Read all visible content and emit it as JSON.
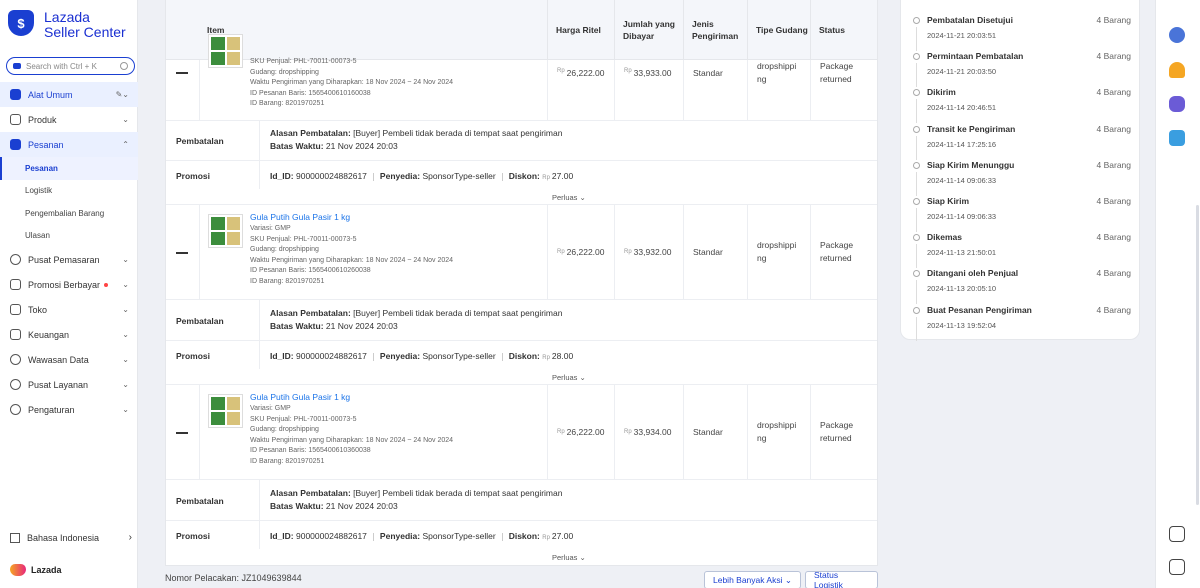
{
  "brand": {
    "line1": "Lazada",
    "line2": "Seller Center",
    "footer": "Lazada"
  },
  "search": {
    "placeholder": "Search with Ctrl + K"
  },
  "nav": {
    "alat_umum": "Alat Umum",
    "produk": "Produk",
    "pesanan": "Pesanan",
    "sub": [
      "Pesanan",
      "Logistik",
      "Pengembalian Barang",
      "Ulasan"
    ],
    "rest": [
      "Pusat Pemasaran",
      "Promosi Berbayar",
      "Toko",
      "Keuangan",
      "Wawasan Data",
      "Pusat Layanan",
      "Pengaturan"
    ],
    "language": "Bahasa Indonesia"
  },
  "table": {
    "headers": {
      "item": "Item",
      "harga": "Harga Ritel",
      "jumlah": "Jumlah yang Dibayar",
      "jenis": "Jenis Pengiriman",
      "tipe": "Tipe Gudang",
      "status": "Status"
    },
    "currency": "Rp",
    "rows": [
      {
        "name": "",
        "variasi": "",
        "sku": "SKU Penjual: PHL-70011-00073-5",
        "gudang": "Gudang: dropshipping",
        "waktu": "Waktu Pengiriman yang Diharapkan: 18 Nov 2024 ~ 24 Nov 2024",
        "id_pesanan": "ID Pesanan Baris: 1565400610160038",
        "id_barang": "ID Barang: 8201970251",
        "harga": "26,222.00",
        "jumlah": "33,933.00",
        "jenis": "Standar",
        "tipe": "dropshippi ng",
        "status": "Package returned",
        "diskon": "27.00"
      },
      {
        "name": "Gula Putih Gula Pasir 1 kg",
        "variasi": "Variasi: GMP",
        "sku": "SKU Penjual: PHL-70011-00073-5",
        "gudang": "Gudang: dropshipping",
        "waktu": "Waktu Pengiriman yang Diharapkan: 18 Nov 2024 ~ 24 Nov 2024",
        "id_pesanan": "ID Pesanan Baris: 1565400610260038",
        "id_barang": "ID Barang: 8201970251",
        "harga": "26,222.00",
        "jumlah": "33,932.00",
        "jenis": "Standar",
        "tipe": "dropshippi ng",
        "status": "Package returned",
        "diskon": "28.00"
      },
      {
        "name": "Gula Putih Gula Pasir 1 kg",
        "variasi": "Variasi: GMP",
        "sku": "SKU Penjual: PHL-70011-00073-5",
        "gudang": "Gudang: dropshipping",
        "waktu": "Waktu Pengiriman yang Diharapkan: 18 Nov 2024 ~ 24 Nov 2024",
        "id_pesanan": "ID Pesanan Baris: 1565400610360038",
        "id_barang": "ID Barang: 8201970251",
        "harga": "26,222.00",
        "jumlah": "33,934.00",
        "jenis": "Standar",
        "tipe": "dropshippi ng",
        "status": "Package returned",
        "diskon": "27.00"
      }
    ],
    "pembatalan_label": "Pembatalan",
    "alasan_label": "Alasan Pembatalan:",
    "alasan_text": "[Buyer] Pembeli tidak berada di tempat saat pengiriman",
    "batas_label": "Batas Waktu:",
    "batas_text": "21 Nov 2024 20:03",
    "promosi_label": "Promosi",
    "id_label": "Id_ID:",
    "id_value": "900000024882617",
    "penyedia_label": "Penyedia:",
    "penyedia_value": "SponsorType-seller",
    "diskon_label": "Diskon:",
    "perluas": "Perluas"
  },
  "bottom": {
    "tracking": "Nomor Pelacakan: JZ1049639844",
    "more_actions": "Lebih Banyak Aksi",
    "status_logistik": "Status Logistik"
  },
  "timeline": [
    {
      "status": "Pembatalan Disetujui",
      "count": "4 Barang",
      "time": "2024-11-21 20:03:51"
    },
    {
      "status": "Permintaan Pembatalan",
      "count": "4 Barang",
      "time": "2024-11-21 20:03:50"
    },
    {
      "status": "Dikirim",
      "count": "4 Barang",
      "time": "2024-11-14 20:46:51"
    },
    {
      "status": "Transit ke Pengiriman",
      "count": "4 Barang",
      "time": "2024-11-14 17:25:16"
    },
    {
      "status": "Siap Kirim Menunggu",
      "count": "4 Barang",
      "time": "2024-11-14 09:06:33"
    },
    {
      "status": "Siap Kirim",
      "count": "4 Barang",
      "time": "2024-11-14 09:06:33"
    },
    {
      "status": "Dikemas",
      "count": "4 Barang",
      "time": "2024-11-13 21:50:01"
    },
    {
      "status": "Ditangani oleh Penjual",
      "count": "4 Barang",
      "time": "2024-11-13 20:05:10"
    },
    {
      "status": "Buat Pesanan Pengiriman",
      "count": "4 Barang",
      "time": "2024-11-13 19:52:04"
    }
  ],
  "colors": {
    "accent": "#1a3fd1",
    "link": "#1a73e8",
    "bg": "#eef0f5"
  }
}
